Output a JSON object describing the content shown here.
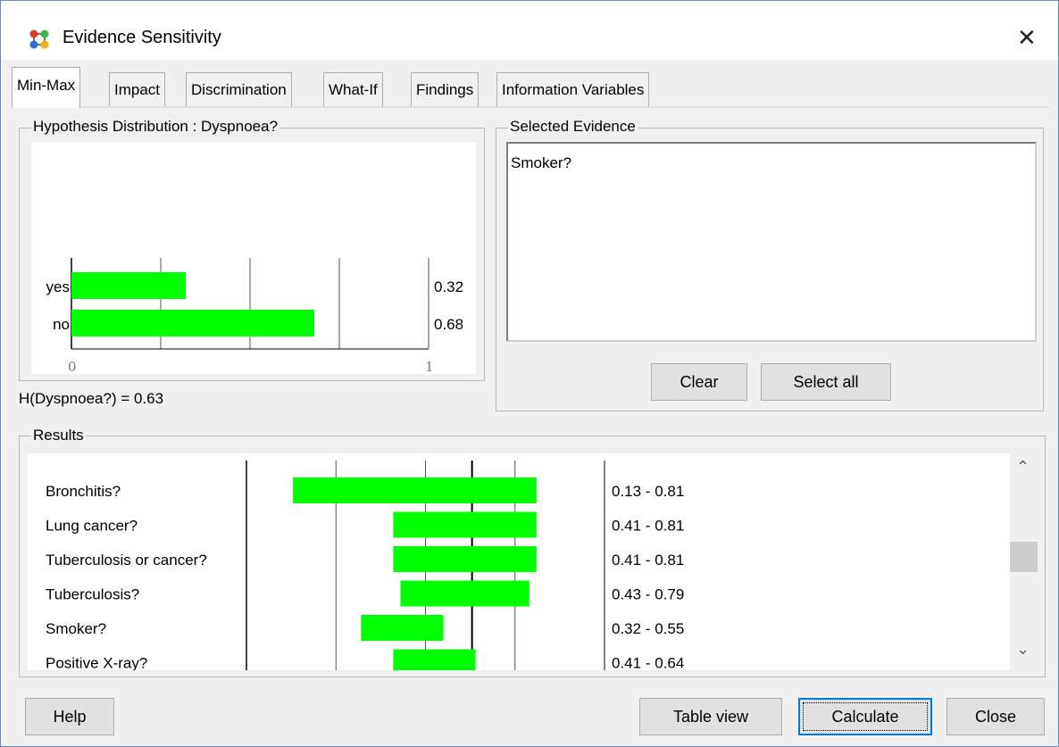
{
  "window": {
    "title": "Evidence Sensitivity",
    "icon": "network-nodes-icon",
    "close_glyph": "✕"
  },
  "tabs": [
    {
      "label": "Min-Max",
      "active": true
    },
    {
      "label": "Impact",
      "active": false
    },
    {
      "label": "Discrimination",
      "active": false
    },
    {
      "label": "What-If",
      "active": false
    },
    {
      "label": "Findings",
      "active": false
    },
    {
      "label": "Information Variables",
      "active": false
    }
  ],
  "hypothesis": {
    "group_label": "Hypothesis Distribution : Dyspnoea?",
    "entropy_text": "H(Dyspnoea?) = 0.63",
    "chart_data": {
      "type": "bar",
      "orientation": "horizontal",
      "categories": [
        "yes",
        "no"
      ],
      "values": [
        0.32,
        0.68
      ],
      "value_labels": [
        "0.32",
        "0.68"
      ],
      "xlim": [
        0,
        1
      ],
      "x_tick_labels": [
        "0",
        "1"
      ],
      "bar_color": "#00ff00"
    }
  },
  "evidence": {
    "group_label": "Selected Evidence",
    "items": [
      "Smoker?"
    ],
    "clear_label": "Clear",
    "select_all_label": "Select all"
  },
  "results": {
    "group_label": "Results",
    "chart_data": {
      "type": "bar",
      "orientation": "horizontal-range",
      "xlim": [
        0,
        1
      ],
      "marker": 0.63,
      "bar_color": "#00ff00",
      "rows": [
        {
          "label": "Bronchitis?",
          "min": 0.13,
          "max": 0.81,
          "range_text": "0.13 - 0.81"
        },
        {
          "label": "Lung cancer?",
          "min": 0.41,
          "max": 0.81,
          "range_text": "0.41 - 0.81"
        },
        {
          "label": "Tuberculosis or cancer?",
          "min": 0.41,
          "max": 0.81,
          "range_text": "0.41 - 0.81"
        },
        {
          "label": "Tuberculosis?",
          "min": 0.43,
          "max": 0.79,
          "range_text": "0.43 - 0.79"
        },
        {
          "label": "Smoker?",
          "min": 0.32,
          "max": 0.55,
          "range_text": "0.32 - 0.55"
        },
        {
          "label": "Positive X-ray?",
          "min": 0.41,
          "max": 0.64,
          "range_text": "0.41 - 0.64"
        }
      ]
    },
    "scroll_up_glyph": "⌃",
    "scroll_down_glyph": "⌄"
  },
  "footer": {
    "help_label": "Help",
    "table_view_label": "Table view",
    "calculate_label": "Calculate",
    "close_label": "Close"
  }
}
